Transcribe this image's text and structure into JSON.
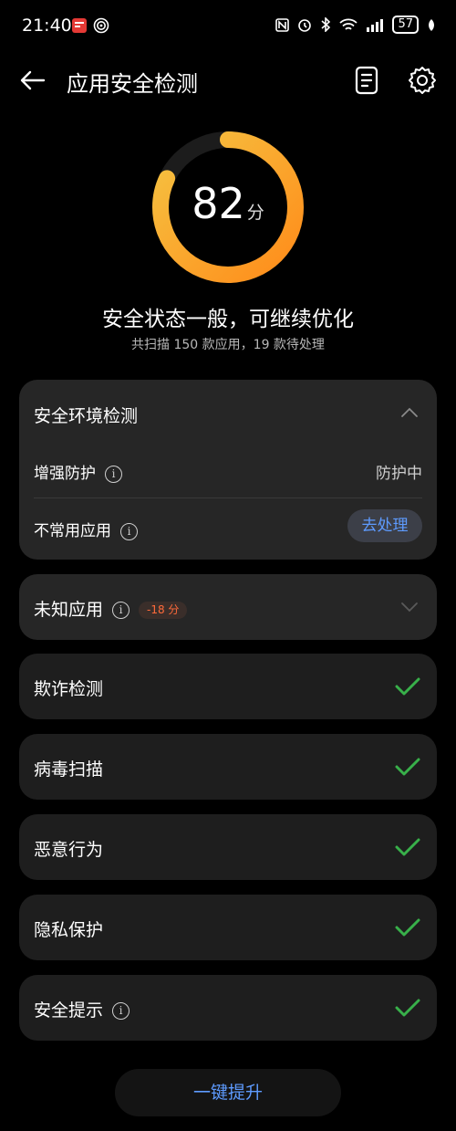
{
  "statusbar": {
    "time": "21:40",
    "battery": "57",
    "icons": [
      "notification-icon",
      "hotspot-icon",
      "nfc-icon",
      "alarm-icon",
      "bluetooth-icon",
      "wifi-icon",
      "signal-icon",
      "battery-icon",
      "leaf-icon"
    ]
  },
  "header": {
    "title": "应用安全检测"
  },
  "score": {
    "value": "82",
    "unit": "分",
    "fraction": 0.82,
    "status": "安全状态一般，可继续优化",
    "summary": "共扫描 150 款应用，19 款待处理"
  },
  "colors": {
    "ring_start": "#f5c342",
    "ring_end": "#ff8c1a",
    "accent_blue": "#5e9bff",
    "check_green": "#38b04a"
  },
  "env_card": {
    "title": "安全环境检测",
    "rows": [
      {
        "label": "增强防护",
        "value": "防护中"
      },
      {
        "label": "不常用应用",
        "action": "去处理"
      }
    ]
  },
  "unknown_apps": {
    "label": "未知应用",
    "badge": "-18 分"
  },
  "items": [
    {
      "label": "欺诈检测",
      "has_info": false
    },
    {
      "label": "病毒扫描",
      "has_info": false
    },
    {
      "label": "恶意行为",
      "has_info": false
    },
    {
      "label": "隐私保护",
      "has_info": false
    },
    {
      "label": "安全提示",
      "has_info": true
    }
  ],
  "bottom_button": "一键提升"
}
